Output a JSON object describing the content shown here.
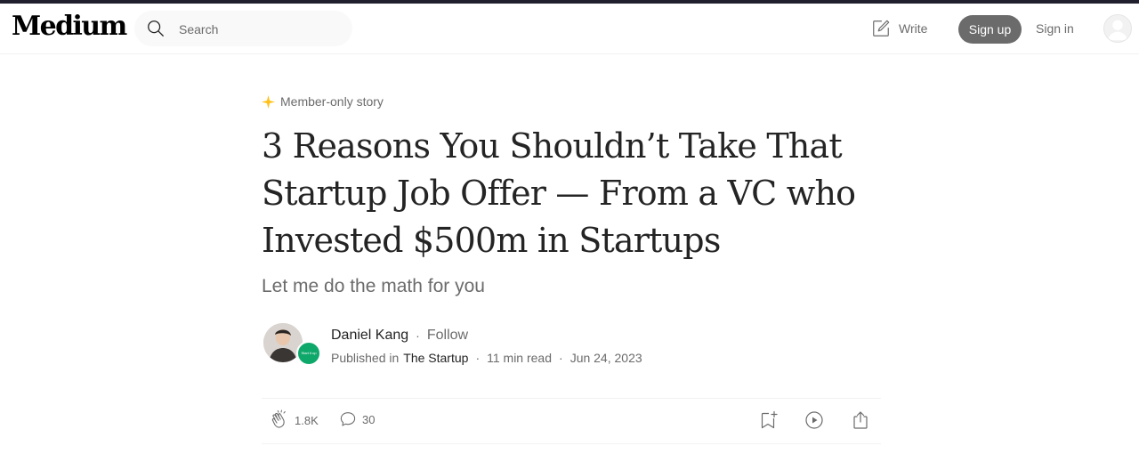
{
  "header": {
    "logo": "Medium",
    "search": {
      "placeholder": "Search",
      "icon": "search-icon"
    },
    "write_label": "Write",
    "signup_label": "Sign up",
    "signin_label": "Sign in"
  },
  "article": {
    "badge": "Member-only story",
    "title": "3 Reasons You Shouldn’t Take That Startup Job Offer — From a VC who Invested $500m in Startups",
    "subtitle": "Let me do the math for you",
    "author": {
      "name": "Daniel Kang",
      "follow_label": "Follow",
      "published_in_label": "Published in",
      "publication": "The Startup",
      "publication_avatar_text": "Start it up",
      "read_time": "11 min read",
      "date": "Jun 24, 2023"
    },
    "actions": {
      "claps": "1.8K",
      "comments": "30"
    }
  },
  "colors": {
    "accent_star": "#ffc017",
    "signup_bg": "#6b6b6b",
    "publication_green": "#0fa86b",
    "muted_text": "#6b6b6b"
  }
}
